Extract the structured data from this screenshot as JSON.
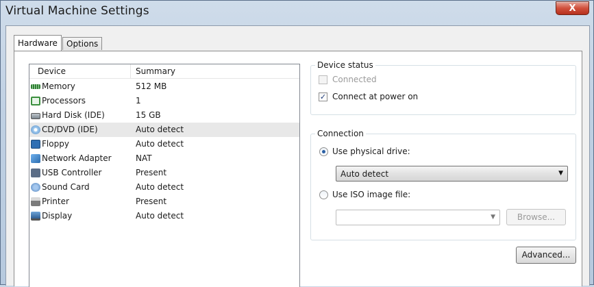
{
  "window": {
    "title": "Virtual Machine Settings",
    "close_symbol": "X"
  },
  "tabs": [
    {
      "label": "Hardware",
      "active": true
    },
    {
      "label": "Options",
      "active": false
    }
  ],
  "device_list": {
    "columns": {
      "device": "Device",
      "summary": "Summary"
    },
    "rows": [
      {
        "icon": "memory-icon",
        "device": "Memory",
        "summary": "512 MB"
      },
      {
        "icon": "processor-icon",
        "device": "Processors",
        "summary": "1"
      },
      {
        "icon": "hard-disk-icon",
        "device": "Hard Disk (IDE)",
        "summary": "15 GB"
      },
      {
        "icon": "cd-dvd-icon",
        "device": "CD/DVD (IDE)",
        "summary": "Auto detect",
        "selected": true
      },
      {
        "icon": "floppy-icon",
        "device": "Floppy",
        "summary": "Auto detect"
      },
      {
        "icon": "network-adapter-icon",
        "device": "Network Adapter",
        "summary": "NAT"
      },
      {
        "icon": "usb-controller-icon",
        "device": "USB Controller",
        "summary": "Present"
      },
      {
        "icon": "sound-card-icon",
        "device": "Sound Card",
        "summary": "Auto detect"
      },
      {
        "icon": "printer-icon",
        "device": "Printer",
        "summary": "Present"
      },
      {
        "icon": "display-icon",
        "device": "Display",
        "summary": "Auto detect"
      }
    ]
  },
  "device_status": {
    "label": "Device status",
    "connected": {
      "label": "Connected",
      "checked": false,
      "enabled": false
    },
    "connect_at_power_on": {
      "label": "Connect at power on",
      "checked": true,
      "enabled": true
    }
  },
  "connection": {
    "label": "Connection",
    "use_physical_drive": {
      "label": "Use physical drive:",
      "checked": true
    },
    "physical_drive_value": "Auto detect",
    "use_iso_image": {
      "label": "Use ISO image file:",
      "checked": false
    },
    "iso_value": "",
    "browse_label": "Browse..."
  },
  "advanced_label": "Advanced...",
  "symbols": {
    "check": "✓",
    "dropdown_arrow": "▼"
  }
}
